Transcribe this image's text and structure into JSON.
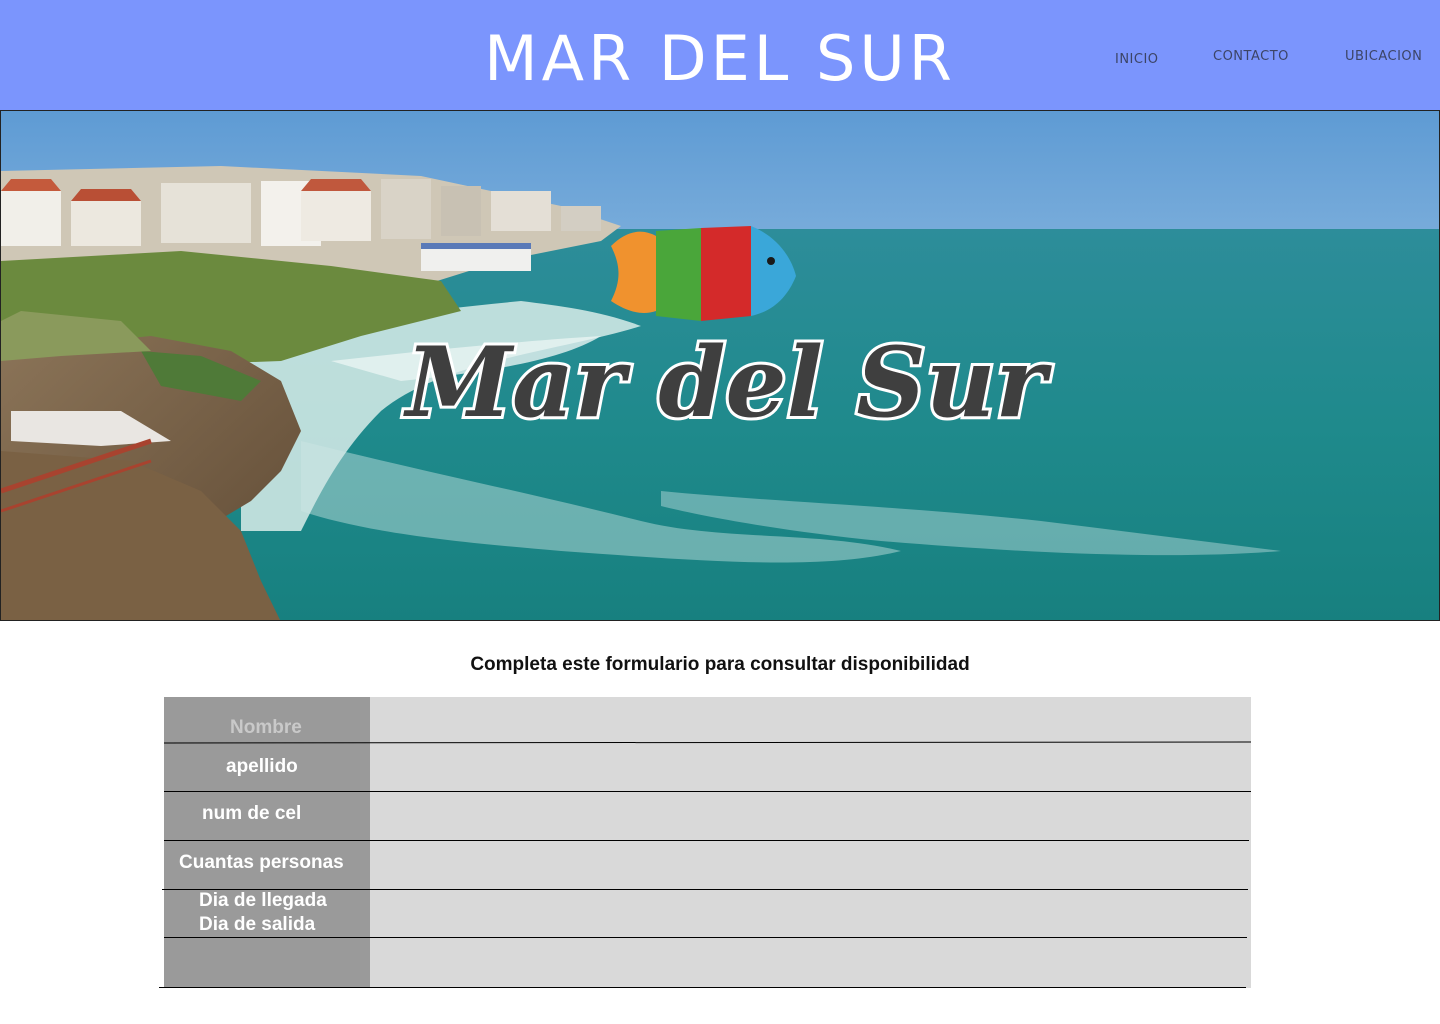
{
  "header": {
    "title": "MAR DEL SUR",
    "nav": {
      "inicio": "INICIO",
      "contacto": "CONTACTO",
      "ubicacion": "UBICACION"
    },
    "background": "#7b95fd"
  },
  "hero": {
    "logo_text": "Mar del Sur"
  },
  "form": {
    "heading": "Completa este formulario para consultar disponibilidad",
    "labels": {
      "nombre": "Nombre",
      "apellido": "apellido",
      "num_cel": "num de cel",
      "personas": "Cuantas personas",
      "llegada": "Dia de llegada",
      "salida": "Dia de salida"
    },
    "label_bg": "#9a9a9a",
    "field_bg": "#d9d9d9"
  }
}
